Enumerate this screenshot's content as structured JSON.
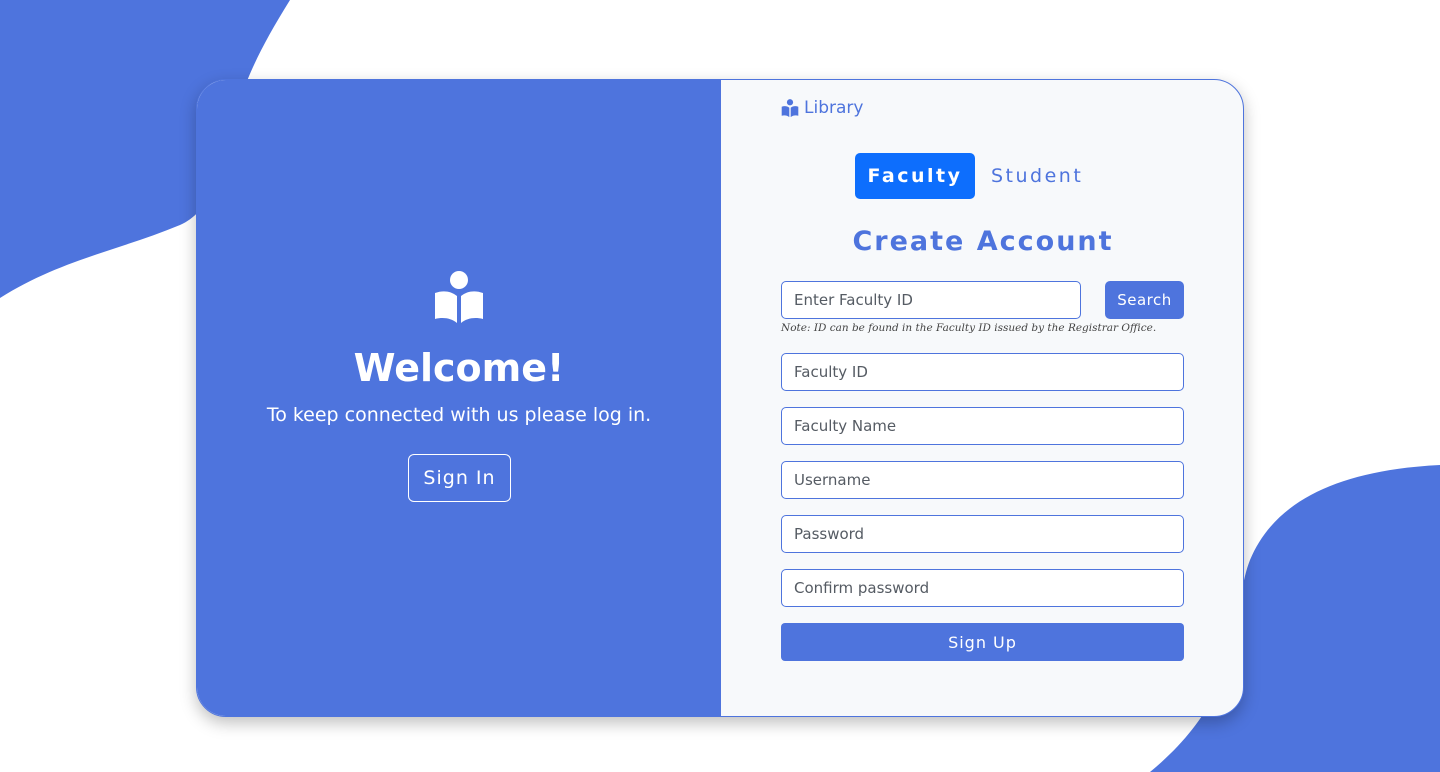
{
  "colors": {
    "primary": "#4e74dd",
    "active_tab": "#0d6efd",
    "panel_bg": "#f7f9fb"
  },
  "left_panel": {
    "icon": "reader-icon",
    "title": "Welcome!",
    "subtitle": "To keep connected with us please log in.",
    "signin_label": "Sign In"
  },
  "brand": {
    "icon": "reader-icon",
    "name": "Library"
  },
  "tabs": [
    {
      "label": "Faculty",
      "active": true
    },
    {
      "label": "Student",
      "active": false
    }
  ],
  "form": {
    "title": "Create Account",
    "search_placeholder": "Enter Faculty ID",
    "search_label": "Search",
    "note": "Note: ID can be found in the Faculty ID issued by the Registrar Office.",
    "fields": [
      {
        "placeholder": "Faculty ID"
      },
      {
        "placeholder": "Faculty Name"
      },
      {
        "placeholder": "Username"
      },
      {
        "placeholder": "Password"
      },
      {
        "placeholder": "Confirm password"
      }
    ],
    "submit_label": "Sign Up"
  }
}
